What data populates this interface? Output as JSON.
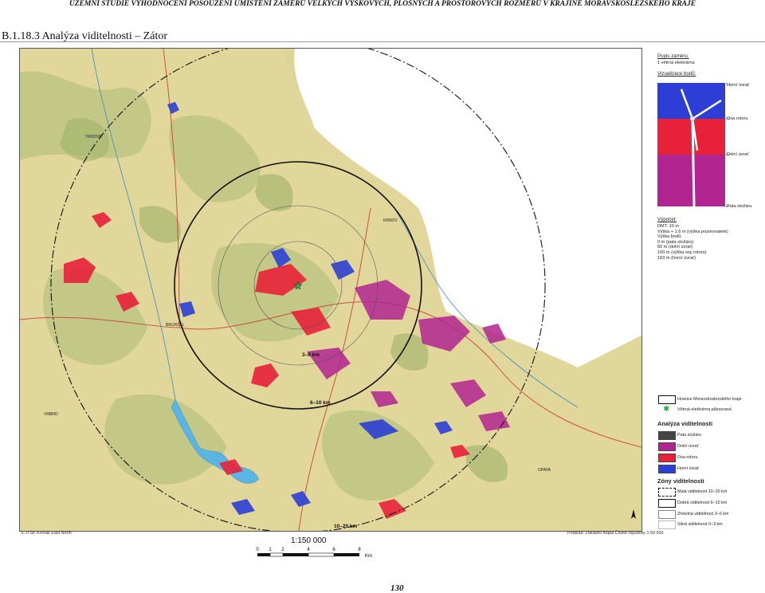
{
  "header": {
    "text": "ÚZEMNÍ STUDIE VYHODNOCENÍ POSOUZENÍ UMÍSTĚNÍ ZÁMĚRŮ VELKÝCH VÝŠKOVÝCH, PLOŠNÝCH A PROSTOROVÝCH ROZMĚRŮ V KRAJINĚ MORAVSKOSLEZSKÉHO KRAJE"
  },
  "section_title": "B.1.18.3  Analýza viditelnosti – Zátor",
  "map": {
    "zone_labels": {
      "inner": "3–6 km",
      "outer": "6–10 km",
      "far": "10–20 km"
    },
    "towns": [
      "KRNOV",
      "OPAVA",
      "BRUNTÁL",
      "TRHOVÉ",
      "VRBNO"
    ],
    "colors": {
      "red": "#e8213a",
      "blue": "#2d3ed6",
      "magenta": "#b22590",
      "dark": "#444444",
      "lake": "#5ab5e3"
    }
  },
  "legend": {
    "popis_label": "Popis záměru:",
    "popis_value": "1 větrná elektrárna",
    "vizualizace_label": "Vizualizace bodů:",
    "turbine_labels": {
      "top": "Horní úvrať",
      "axis": "Osa rotoru",
      "bottom": "Dolní úvrať",
      "base": "Pata stožáru"
    },
    "vypocet_label": "Výpočet:",
    "vypocet_lines": "DMT: 10 m\nVýška + 1,6 m (výška pozorovatele)\nVýška bodů:\n0 m (pata stožáru)\n60 m (dolní úvrať)\n100 m (výška osy rotoru)\n163 m (horní úvrať)",
    "boundary": "Hranice Moravskoslezského kraje",
    "turbine_plan": "Větrná elektrárna plánovaná",
    "analysis_title": "Analýza viditelnosti",
    "analysis_items": [
      {
        "label": "Pata stožáru",
        "color": "#444444"
      },
      {
        "label": "Dolní úvrať",
        "color": "#b22590"
      },
      {
        "label": "Osa rotoru",
        "color": "#e8213a"
      },
      {
        "label": "Horní úvrať",
        "color": "#2d3ed6"
      }
    ],
    "zones_title": "Zóny viditelnosti",
    "zones_items": [
      "Malá viditelnost 10–20 km",
      "Dobrá viditelnost 6–10 km",
      "Zřetelná viditelnost 3–6 km",
      "Silná viditelnost 0–3 km"
    ]
  },
  "source_left": "S-JTSK Krovak East North",
  "source_right": "Podklad: Základní mapa České republiky 1:50 000",
  "scale": {
    "ratio": "1:150 000",
    "ticks": [
      "0",
      "1",
      "2",
      "4",
      "6",
      "8"
    ],
    "unit": "Km"
  },
  "page_number": "130"
}
